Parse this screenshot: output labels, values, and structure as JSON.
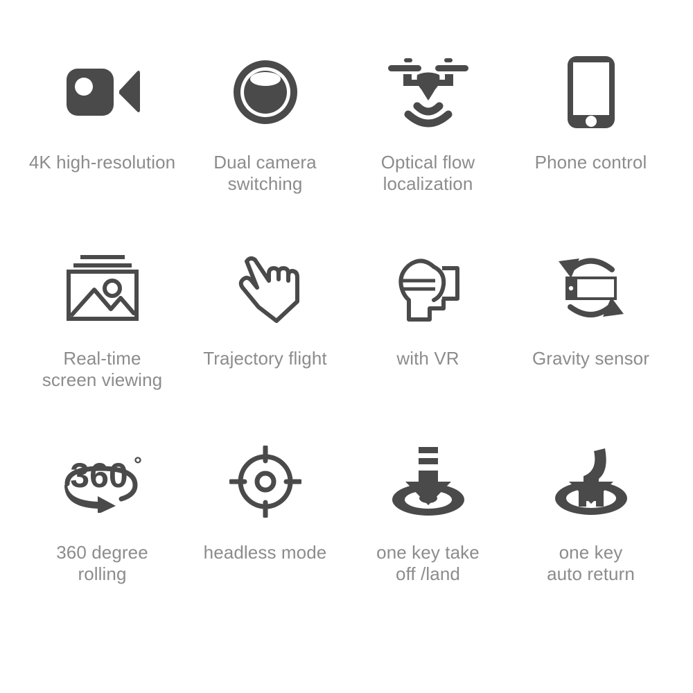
{
  "page": {
    "background_color": "#ffffff",
    "icon_color": "#4a4a4a",
    "label_color": "#8c8c8c"
  },
  "features": [
    {
      "icon": "video-camera-icon",
      "label": "4K high-resolution",
      "row": 1,
      "column": 1
    },
    {
      "icon": "camera-lens-icon",
      "label": "Dual camera\nswitching",
      "row": 1,
      "column": 2
    },
    {
      "icon": "drone-signal-icon",
      "label": "Optical flow\nlocalization",
      "row": 1,
      "column": 3
    },
    {
      "icon": "smartphone-icon",
      "label": "Phone control",
      "row": 1,
      "column": 4
    },
    {
      "icon": "photo-gallery-icon",
      "label": "Real-time\nscreen viewing",
      "row": 2,
      "column": 1
    },
    {
      "icon": "pointing-hand-icon",
      "label": "Trajectory flight",
      "row": 2,
      "column": 2
    },
    {
      "icon": "vr-headset-icon",
      "label": "with VR",
      "row": 2,
      "column": 3
    },
    {
      "icon": "gravity-rotation-icon",
      "label": "Gravity sensor",
      "row": 2,
      "column": 4
    },
    {
      "icon": "360-degree-rotation-icon",
      "label": "360 degree\nrolling",
      "row": 3,
      "column": 1,
      "icon_text": "360",
      "icon_text_suffix": "°"
    },
    {
      "icon": "crosshair-target-icon",
      "label": "headless mode",
      "row": 3,
      "column": 2
    },
    {
      "icon": "takeoff-land-icon",
      "label": "one key take\noff /land",
      "row": 3,
      "column": 3
    },
    {
      "icon": "auto-return-helipad-icon",
      "label": "one key\nauto return",
      "row": 3,
      "column": 4,
      "icon_text": "H"
    }
  ]
}
